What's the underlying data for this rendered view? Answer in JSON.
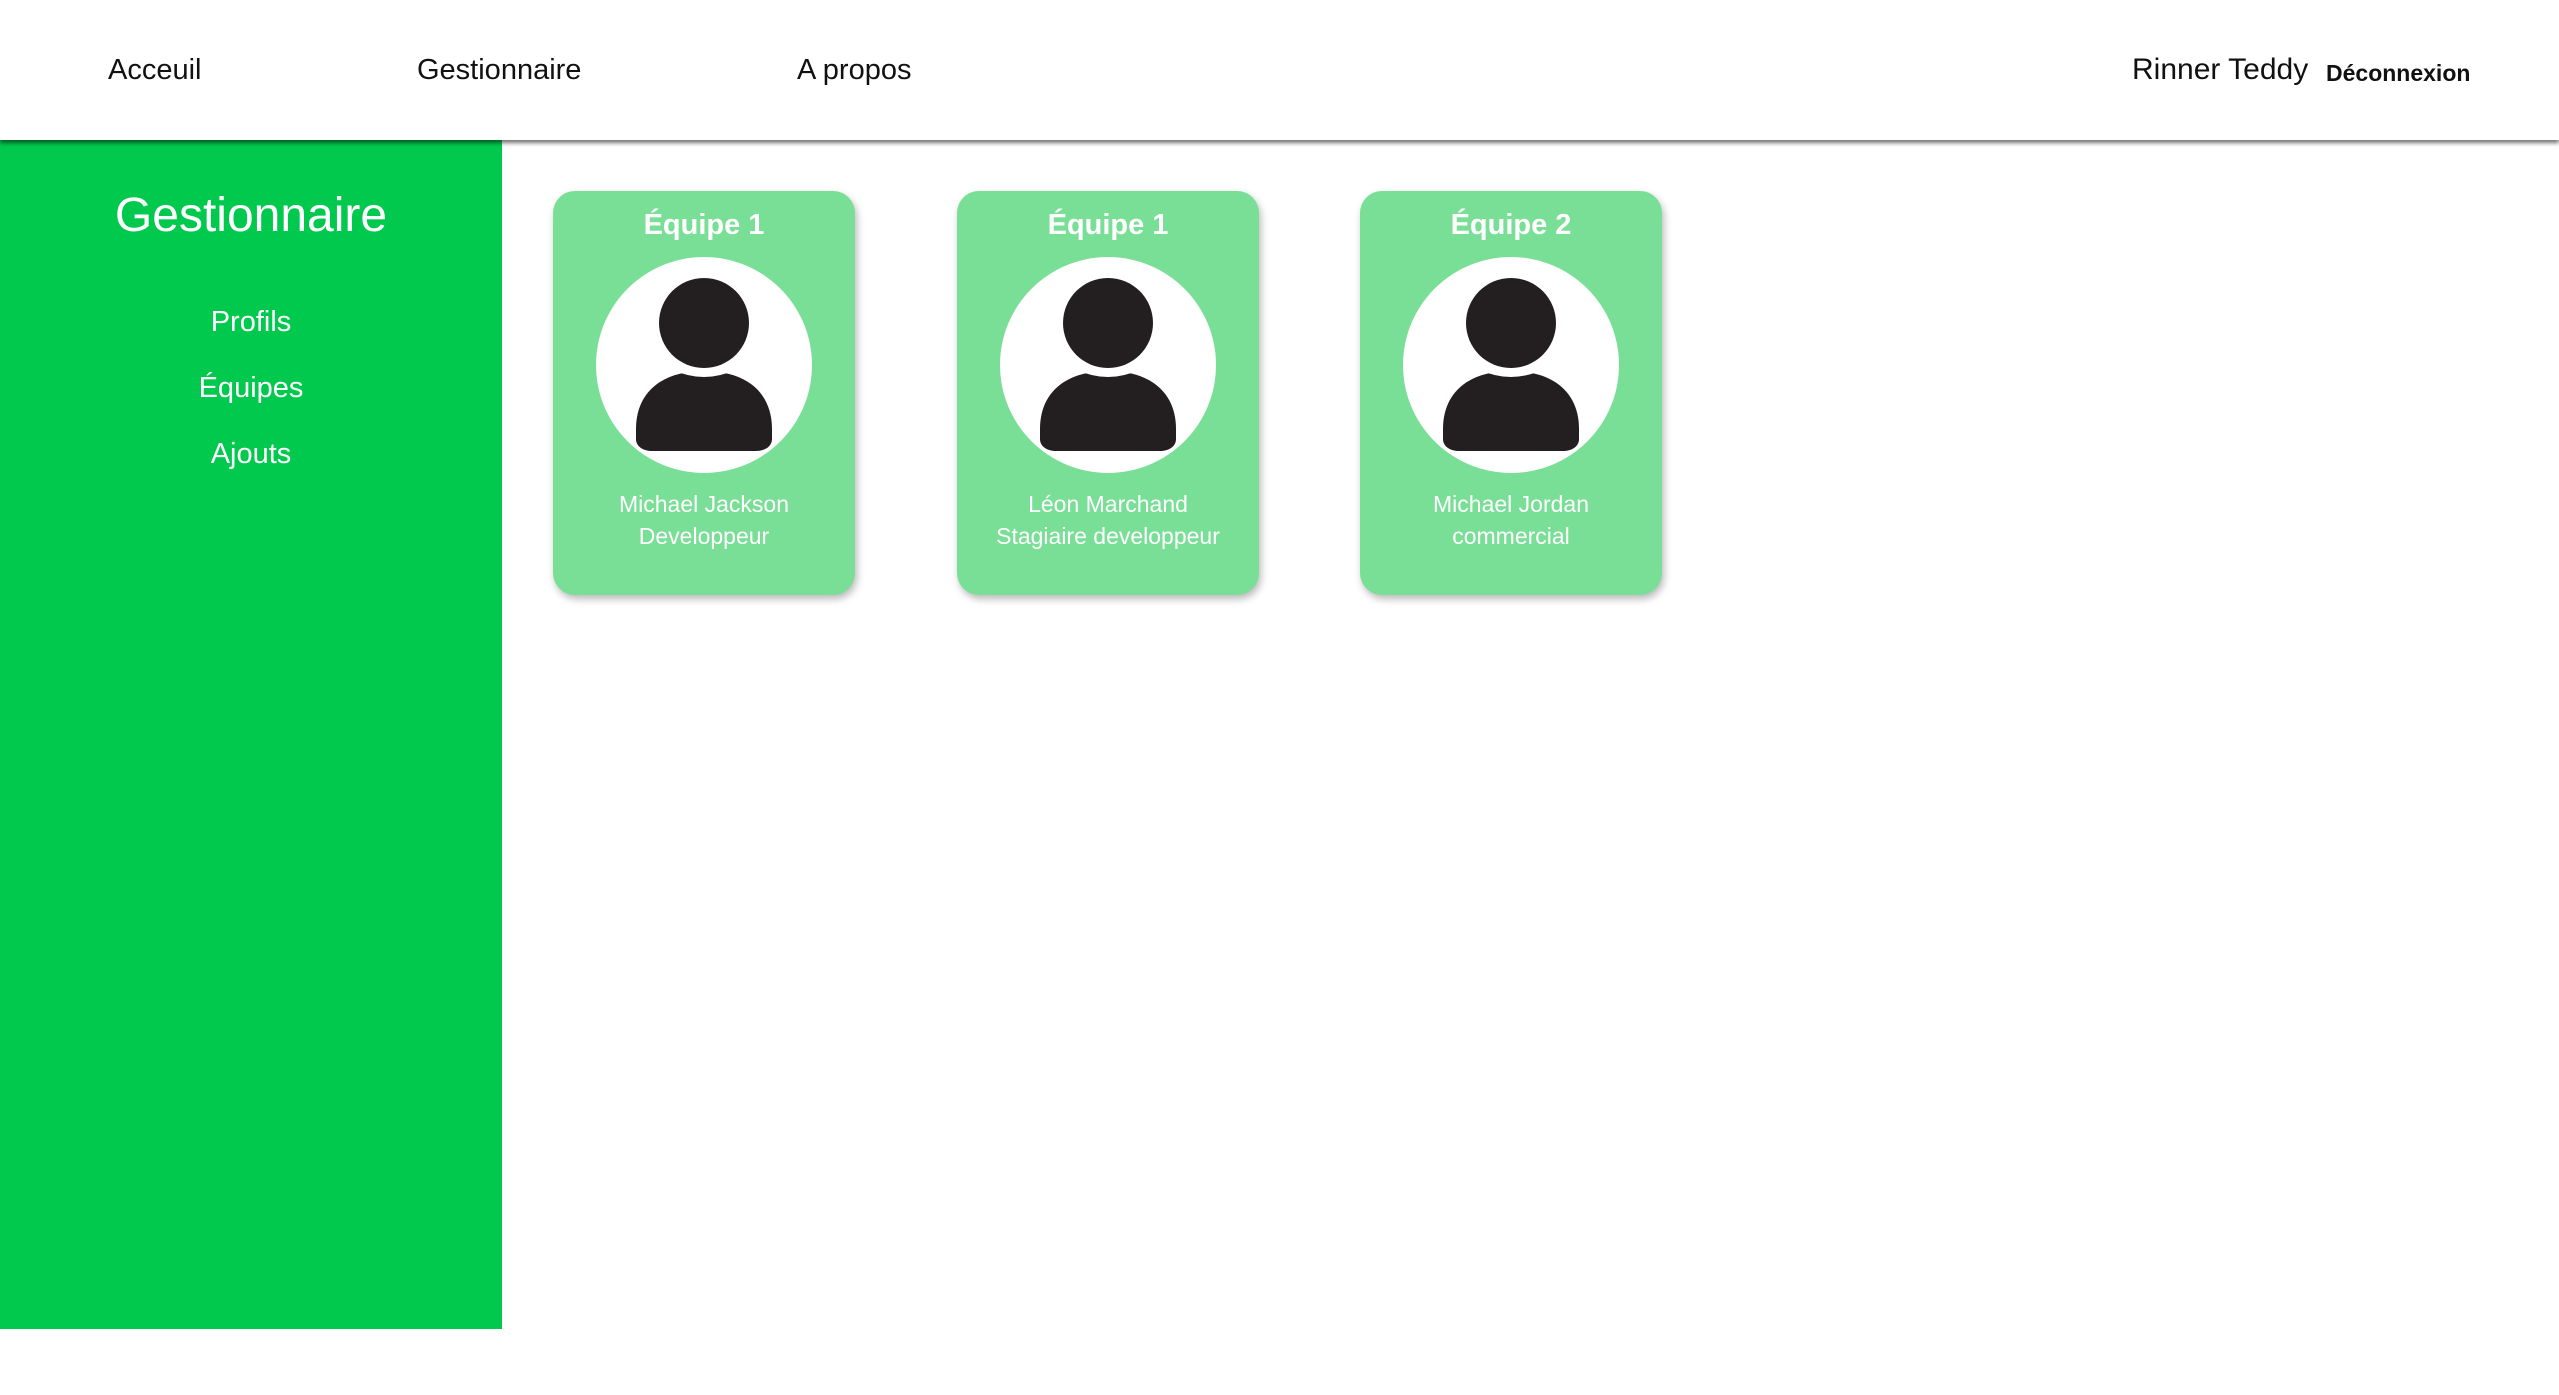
{
  "nav": {
    "links": [
      "Acceuil",
      "Gestionnaire",
      "A propos"
    ],
    "user_name": "Rinner Teddy",
    "logout_label": "Déconnexion"
  },
  "sidebar": {
    "title": "Gestionnaire",
    "items": [
      {
        "label": "Profils"
      },
      {
        "label": "Équipes"
      },
      {
        "label": "Ajouts"
      }
    ]
  },
  "cards": [
    {
      "team": "Équipe 1",
      "name": "Michael Jackson",
      "role": "Developpeur",
      "icon": "user-icon"
    },
    {
      "team": "Équipe 1",
      "name": "Léon Marchand",
      "role": "Stagiaire developpeur",
      "icon": "user-icon"
    },
    {
      "team": "Équipe 2",
      "name": "Michael Jordan",
      "role": "commercial",
      "icon": "user-icon"
    }
  ],
  "colors": {
    "sidebar_green": "#00c94e",
    "card_green": "#79df96",
    "avatar_fill": "#231f20"
  }
}
